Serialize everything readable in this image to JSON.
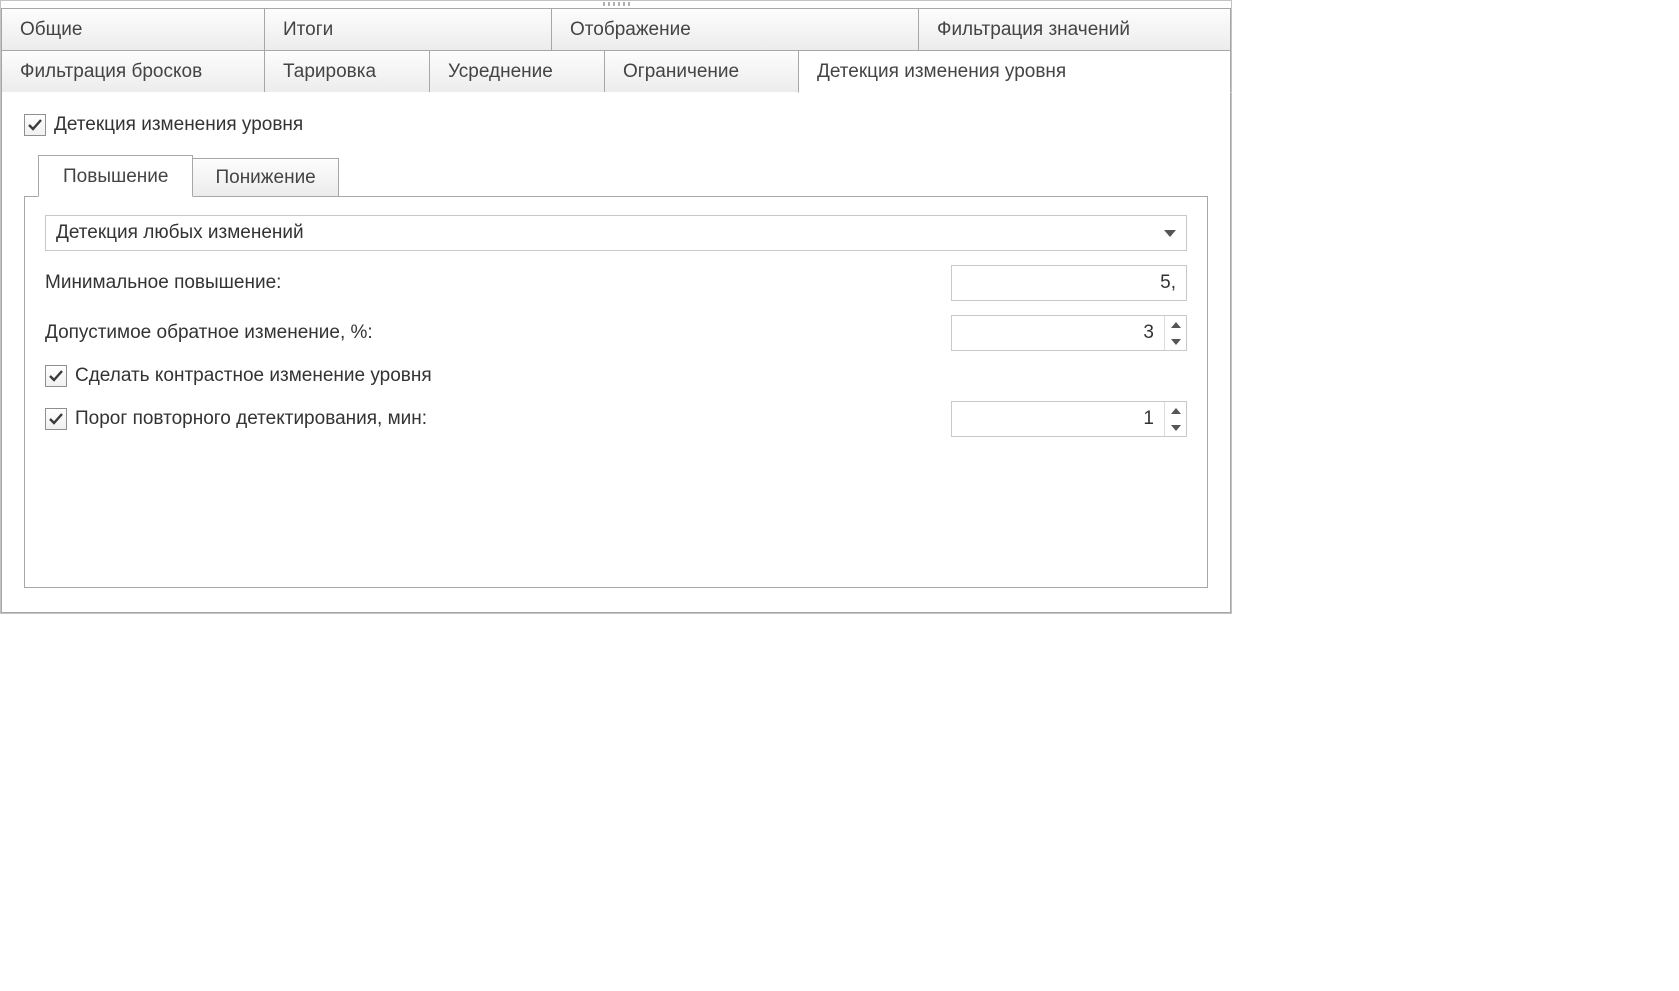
{
  "outer_tabs_row1": [
    {
      "label": "Общие"
    },
    {
      "label": "Итоги"
    },
    {
      "label": "Отображение"
    },
    {
      "label": "Фильтрация значений"
    }
  ],
  "outer_tabs_row2": [
    {
      "label": "Фильтрация бросков"
    },
    {
      "label": "Тарировка"
    },
    {
      "label": "Усреднение"
    },
    {
      "label": "Ограничение"
    },
    {
      "label": "Детекция изменения уровня",
      "active": true
    }
  ],
  "detect_checkbox": {
    "label": "Детекция изменения уровня",
    "checked": true
  },
  "inner_tabs": [
    {
      "label": "Повышение",
      "active": true
    },
    {
      "label": "Понижение"
    }
  ],
  "combo": {
    "value": "Детекция любых изменений"
  },
  "min_raise": {
    "label": "Минимальное повышение:",
    "value": "5,"
  },
  "allowed_rev": {
    "label": "Допустимое обратное изменение, %:",
    "value": "3"
  },
  "contrast": {
    "label": "Сделать контрастное изменение уровня",
    "checked": true
  },
  "repeat_thr": {
    "label": "Порог повторного детектирования, мин:",
    "checked": true,
    "value": "1"
  }
}
